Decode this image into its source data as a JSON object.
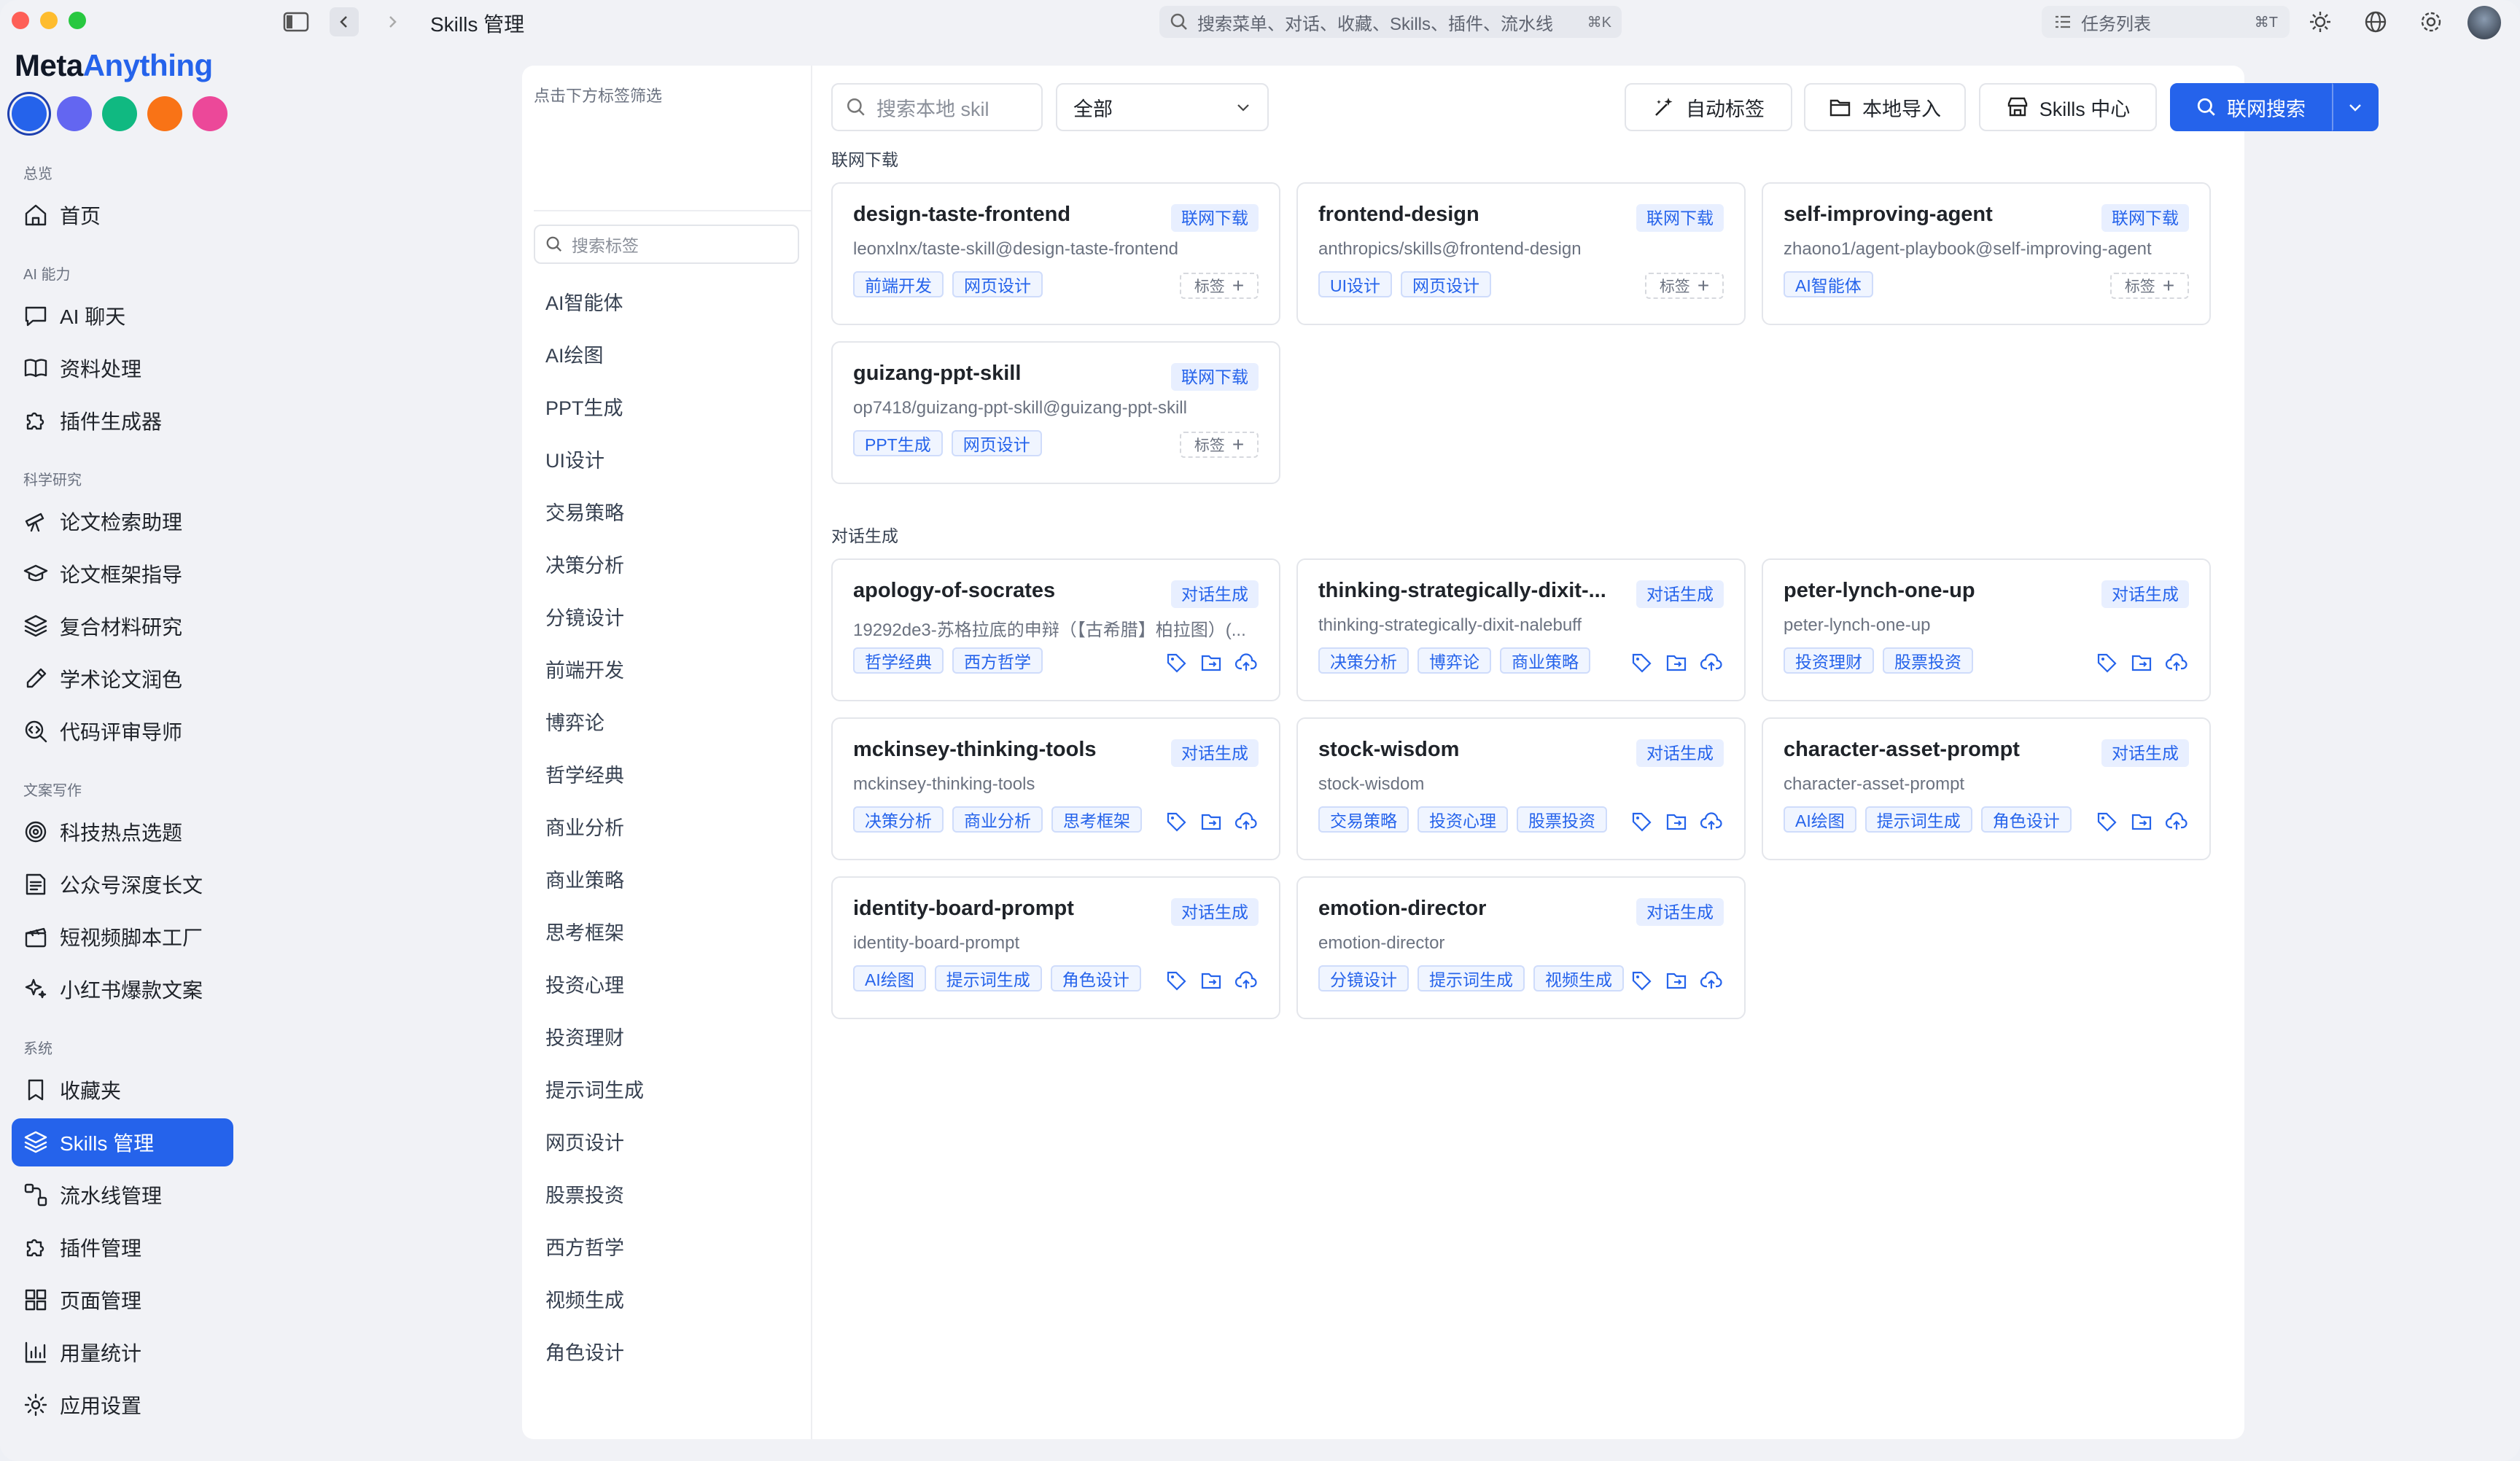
{
  "window": {
    "title": "Skills 管理",
    "search_placeholder": "搜索菜单、对话、收藏、Skills、插件、流水线",
    "search_shortcut": "⌘K",
    "tasks_label": "任务列表",
    "tasks_shortcut": "⌘T"
  },
  "brand": {
    "part1": "Meta",
    "part2": "Anything"
  },
  "theme_colors": [
    "#2563eb",
    "#6366f1",
    "#10b981",
    "#f97316",
    "#ec4899"
  ],
  "sidebar": {
    "groups": [
      {
        "label": "总览",
        "items": [
          {
            "label": "首页",
            "icon": "home-icon"
          }
        ]
      },
      {
        "label": "AI 能力",
        "items": [
          {
            "label": "AI 聊天",
            "icon": "chat-icon"
          },
          {
            "label": "资料处理",
            "icon": "book-icon"
          },
          {
            "label": "插件生成器",
            "icon": "puzzle-icon"
          }
        ]
      },
      {
        "label": "科学研究",
        "items": [
          {
            "label": "论文检索助理",
            "icon": "telescope-icon"
          },
          {
            "label": "论文框架指导",
            "icon": "graduation-cap-icon"
          },
          {
            "label": "复合材料研究",
            "icon": "layers-icon"
          },
          {
            "label": "学术论文润色",
            "icon": "pen-icon"
          },
          {
            "label": "代码评审导师",
            "icon": "search-code-icon"
          }
        ]
      },
      {
        "label": "文案写作",
        "items": [
          {
            "label": "科技热点选题",
            "icon": "target-icon"
          },
          {
            "label": "公众号深度长文",
            "icon": "article-icon"
          },
          {
            "label": "短视频脚本工厂",
            "icon": "clapperboard-icon"
          },
          {
            "label": "小红书爆款文案",
            "icon": "sparkles-icon"
          }
        ]
      },
      {
        "label": "系统",
        "items": [
          {
            "label": "收藏夹",
            "icon": "bookmark-icon"
          },
          {
            "label": "Skills 管理",
            "icon": "layers-icon",
            "active": true
          },
          {
            "label": "流水线管理",
            "icon": "workflow-icon"
          },
          {
            "label": "插件管理",
            "icon": "puzzle-icon"
          },
          {
            "label": "页面管理",
            "icon": "grid-icon"
          },
          {
            "label": "用量统计",
            "icon": "bar-chart-icon"
          },
          {
            "label": "应用设置",
            "icon": "gear-icon"
          }
        ]
      }
    ]
  },
  "tags_panel": {
    "hint": "点击下方标签筛选",
    "search_placeholder": "搜索标签",
    "tags": [
      "AI智能体",
      "AI绘图",
      "PPT生成",
      "UI设计",
      "交易策略",
      "决策分析",
      "分镜设计",
      "前端开发",
      "博弈论",
      "哲学经典",
      "商业分析",
      "商业策略",
      "思考框架",
      "投资心理",
      "投资理财",
      "提示词生成",
      "网页设计",
      "股票投资",
      "西方哲学",
      "视频生成",
      "角色设计"
    ]
  },
  "toolbar": {
    "search_placeholder": "搜索本地 skil",
    "scope_value": "全部",
    "auto_tag_label": "自动标签",
    "local_import_label": "本地导入",
    "skills_center_label": "Skills 中心",
    "web_search_label": "联网搜索"
  },
  "sections": [
    {
      "label": "联网下载",
      "cards": [
        {
          "title": "design-taste-frontend",
          "badge": "联网下载",
          "desc": "leonxlnx/taste-skill@design-taste-frontend",
          "tags": [
            "前端开发",
            "网页设计"
          ],
          "add_tag": "标签"
        },
        {
          "title": "frontend-design",
          "badge": "联网下载",
          "desc": "anthropics/skills@frontend-design",
          "tags": [
            "UI设计",
            "网页设计"
          ],
          "add_tag": "标签"
        },
        {
          "title": "self-improving-agent",
          "badge": "联网下载",
          "desc": "zhaono1/agent-playbook@self-improving-agent",
          "tags": [
            "AI智能体"
          ],
          "add_tag": "标签"
        },
        {
          "title": "guizang-ppt-skill",
          "badge": "联网下载",
          "desc": "op7418/guizang-ppt-skill@guizang-ppt-skill",
          "tags": [
            "PPT生成",
            "网页设计"
          ],
          "add_tag": "标签"
        }
      ]
    },
    {
      "label": "对话生成",
      "cards": [
        {
          "title": "apology-of-socrates",
          "badge": "对话生成",
          "desc": "19292de3-苏格拉底的申辩（【古希腊】柏拉图）(...",
          "tags": [
            "哲学经典",
            "西方哲学"
          ]
        },
        {
          "title": "thinking-strategically-dixit-...",
          "badge": "对话生成",
          "desc": "thinking-strategically-dixit-nalebuff",
          "tags": [
            "决策分析",
            "博弈论",
            "商业策略"
          ]
        },
        {
          "title": "peter-lynch-one-up",
          "badge": "对话生成",
          "desc": "peter-lynch-one-up",
          "tags": [
            "投资理财",
            "股票投资"
          ]
        },
        {
          "title": "mckinsey-thinking-tools",
          "badge": "对话生成",
          "desc": "mckinsey-thinking-tools",
          "tags": [
            "决策分析",
            "商业分析",
            "思考框架"
          ]
        },
        {
          "title": "stock-wisdom",
          "badge": "对话生成",
          "desc": "stock-wisdom",
          "tags": [
            "交易策略",
            "投资心理",
            "股票投资"
          ]
        },
        {
          "title": "character-asset-prompt",
          "badge": "对话生成",
          "desc": "character-asset-prompt",
          "tags": [
            "AI绘图",
            "提示词生成",
            "角色设计"
          ]
        },
        {
          "title": "identity-board-prompt",
          "badge": "对话生成",
          "desc": "identity-board-prompt",
          "tags": [
            "AI绘图",
            "提示词生成",
            "角色设计"
          ]
        },
        {
          "title": "emotion-director",
          "badge": "对话生成",
          "desc": "emotion-director",
          "tags": [
            "分镜设计",
            "提示词生成",
            "视频生成"
          ]
        }
      ]
    }
  ]
}
